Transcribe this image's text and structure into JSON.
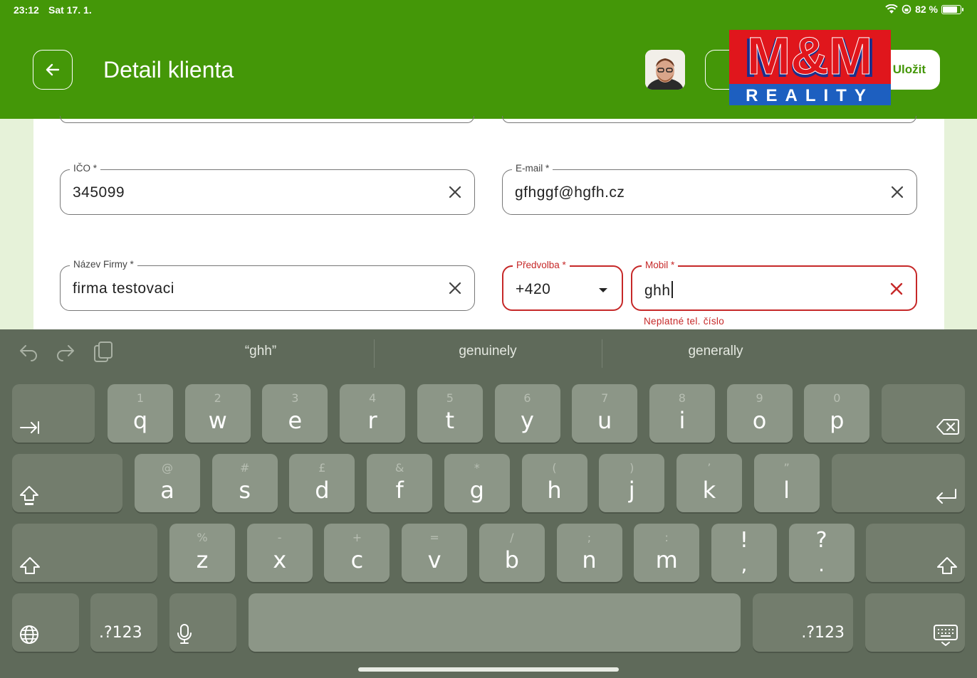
{
  "status": {
    "time": "23:12",
    "date": "Sat 17. 1.",
    "battery": "82 %",
    "battery_level": 0.82
  },
  "header": {
    "title": "Detail klienta",
    "save_label": "Uložit",
    "secondary_label": "",
    "logo_text": "M&M REALITY"
  },
  "form": {
    "ico": {
      "label": "IČO *",
      "value": "345099"
    },
    "email": {
      "label": "E-mail *",
      "value": "gfhggf@hgfh.cz"
    },
    "company": {
      "label": "Název Firmy *",
      "value": "firma testovaci"
    },
    "prefix": {
      "label": "Předvolba *",
      "value": "+420"
    },
    "mobile": {
      "label": "Mobil *",
      "value": "ghh",
      "error": "Neplatné tel. číslo"
    }
  },
  "keyboard": {
    "suggestions": [
      "“ghh”",
      "genuinely",
      "generally"
    ],
    "row1": [
      {
        "k": "q",
        "h": "1"
      },
      {
        "k": "w",
        "h": "2"
      },
      {
        "k": "e",
        "h": "3"
      },
      {
        "k": "r",
        "h": "4"
      },
      {
        "k": "t",
        "h": "5"
      },
      {
        "k": "y",
        "h": "6"
      },
      {
        "k": "u",
        "h": "7"
      },
      {
        "k": "i",
        "h": "8"
      },
      {
        "k": "o",
        "h": "9"
      },
      {
        "k": "p",
        "h": "0"
      }
    ],
    "row2": [
      {
        "k": "a",
        "h": "@"
      },
      {
        "k": "s",
        "h": "#"
      },
      {
        "k": "d",
        "h": "£"
      },
      {
        "k": "f",
        "h": "&"
      },
      {
        "k": "g",
        "h": "*"
      },
      {
        "k": "h",
        "h": "("
      },
      {
        "k": "j",
        "h": ")"
      },
      {
        "k": "k",
        "h": "’"
      },
      {
        "k": "l",
        "h": "”"
      }
    ],
    "row3": [
      {
        "k": "z",
        "h": "%"
      },
      {
        "k": "x",
        "h": "-"
      },
      {
        "k": "c",
        "h": "+"
      },
      {
        "k": "v",
        "h": "="
      },
      {
        "k": "b",
        "h": "/"
      },
      {
        "k": "n",
        "h": ";"
      },
      {
        "k": "m",
        "h": ":"
      },
      {
        "k": ",",
        "h": "!"
      },
      {
        "k": ".",
        "h": "?"
      }
    ],
    "numbers_label": ".?123",
    "numbers_label_right": ".?123"
  },
  "colors": {
    "primary": "#449708",
    "error": "#c62828",
    "keyboard_bg": "#5f6a5a",
    "key": "#8c9687"
  }
}
